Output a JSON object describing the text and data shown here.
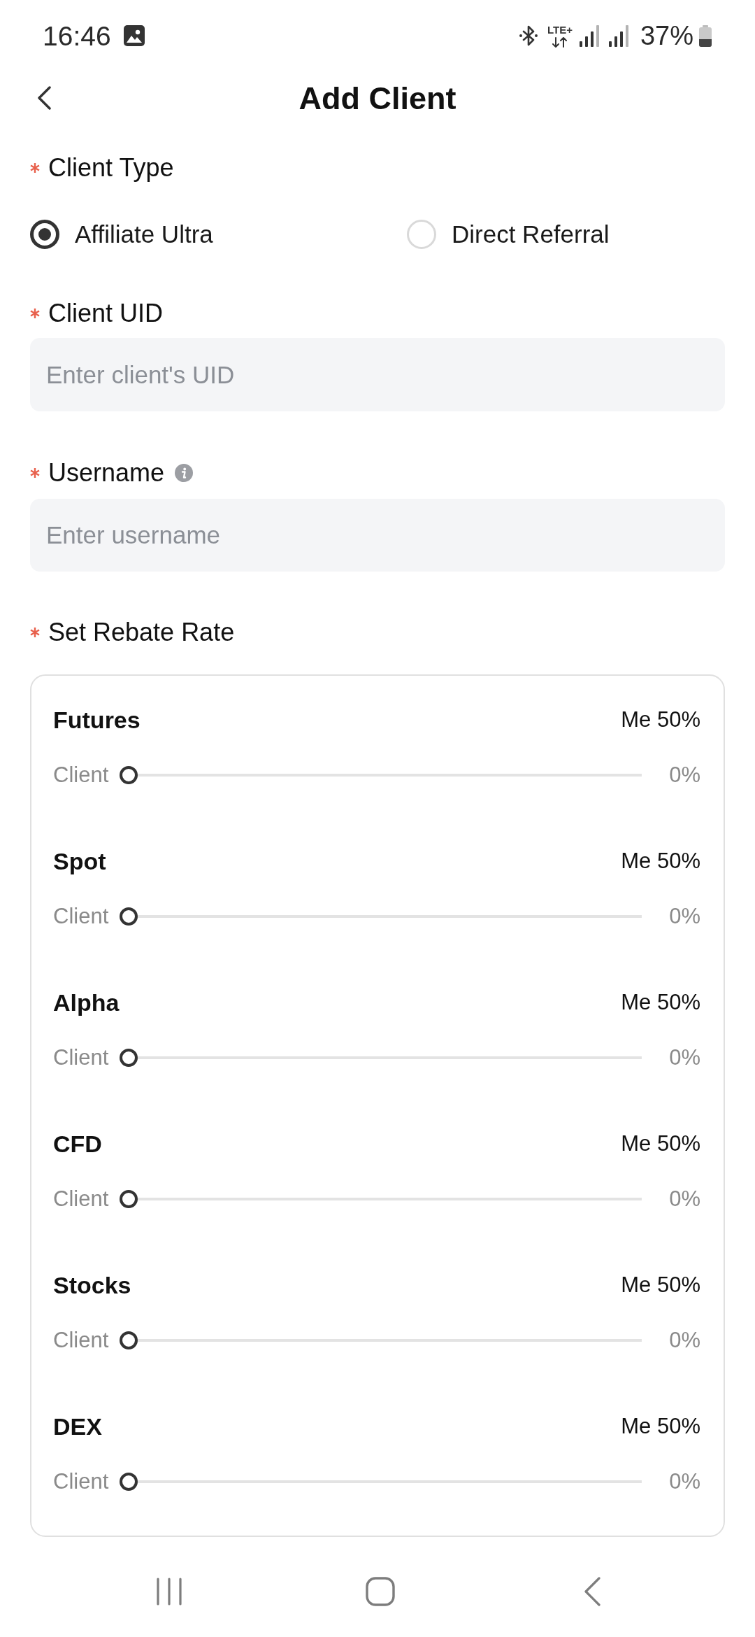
{
  "status_bar": {
    "time": "16:46",
    "network": "LTE+",
    "battery": "37%"
  },
  "header": {
    "title": "Add Client"
  },
  "client_type": {
    "label": "Client Type",
    "required": true,
    "options": [
      {
        "label": "Affiliate Ultra",
        "selected": true
      },
      {
        "label": "Direct Referral",
        "selected": false
      }
    ]
  },
  "client_uid": {
    "label": "Client UID",
    "required": true,
    "placeholder": "Enter client's UID"
  },
  "username": {
    "label": "Username",
    "required": true,
    "info": true,
    "placeholder": "Enter username"
  },
  "rebate_rate": {
    "label": "Set Rebate Rate",
    "required": true,
    "products": [
      {
        "name": "Futures",
        "my_share": "Me 50%",
        "slider_label": "Client",
        "level": 0,
        "reading": "0%"
      },
      {
        "name": "Spot",
        "my_share": "Me 50%",
        "slider_label": "Client",
        "level": 0,
        "reading": "0%"
      },
      {
        "name": "Alpha",
        "my_share": "Me 50%",
        "slider_label": "Client",
        "level": 0,
        "reading": "0%"
      },
      {
        "name": "CFD",
        "my_share": "Me 50%",
        "slider_label": "Client",
        "level": 0,
        "reading": "0%"
      },
      {
        "name": "Stocks",
        "my_share": "Me 50%",
        "slider_label": "Client",
        "level": 0,
        "reading": "0%"
      },
      {
        "name": "DEX",
        "my_share": "Me 50%",
        "slider_label": "Client",
        "level": 0,
        "reading": "0%"
      }
    ]
  }
}
